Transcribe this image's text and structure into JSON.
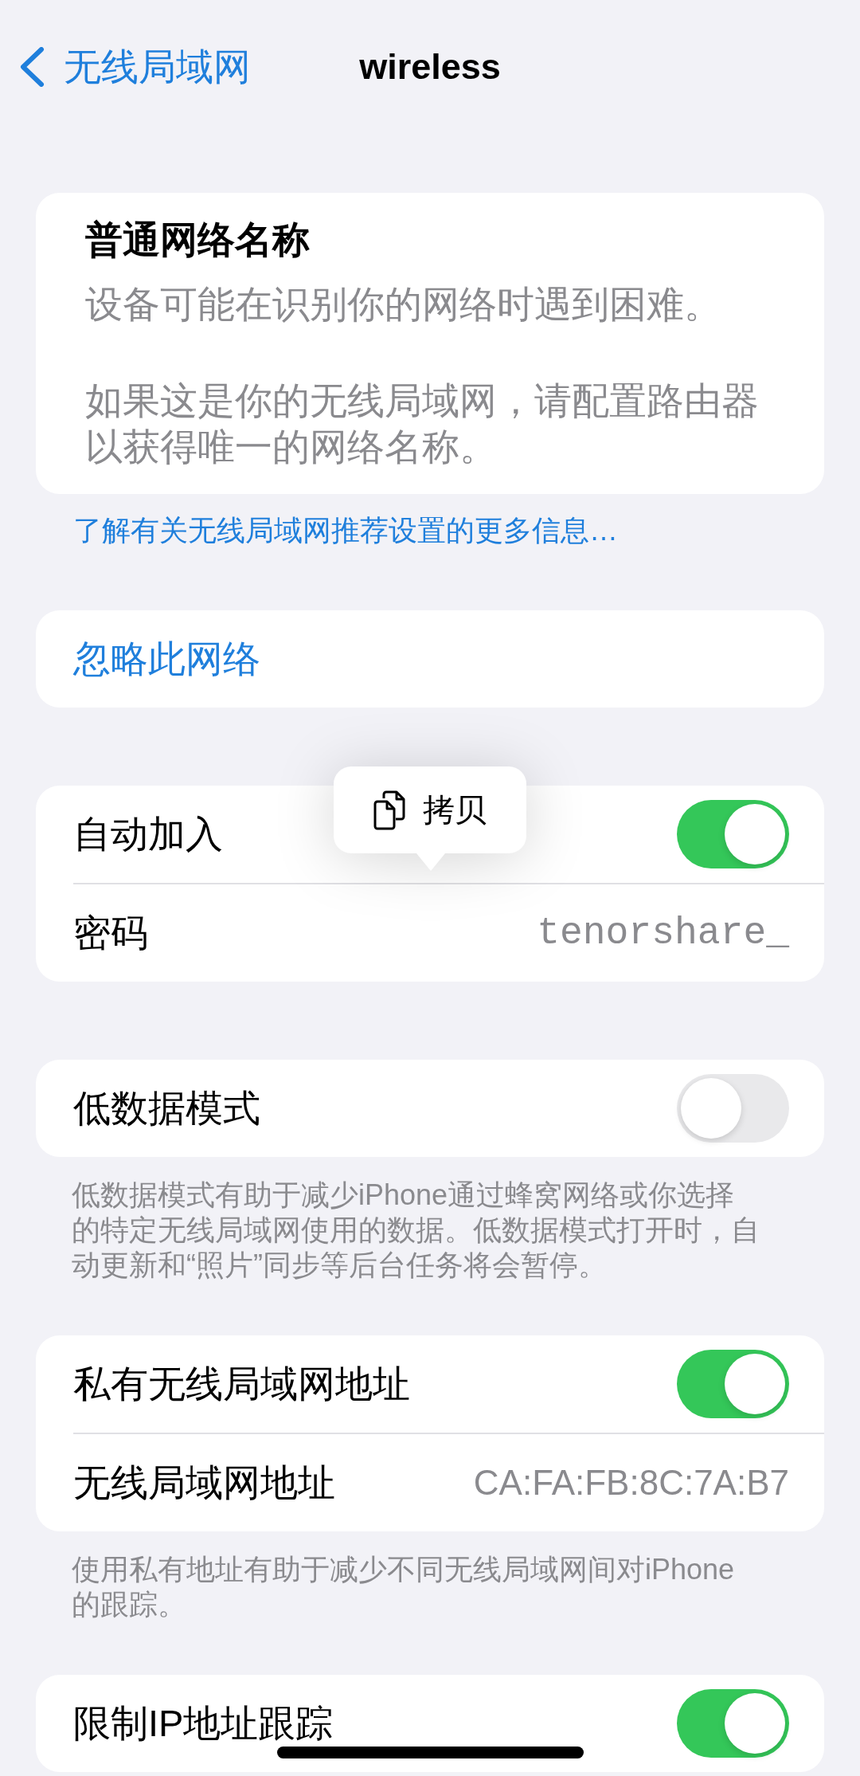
{
  "nav_bar": {
    "back_label": "无线局域网",
    "title": "wireless"
  },
  "sections": [
    {
      "kind": "notice",
      "title": "普通网络名称",
      "paragraphs": [
        "设备可能在识别你的网络时遇到困难。",
        "如果这是你的无线局域网，请配置路由器以获得唯一的网络名称。"
      ],
      "link": "了解有关无线局域网推荐设置的更多信息…"
    },
    {
      "kind": "group",
      "rows": [
        {
          "kind": "action",
          "label": "忽略此网络"
        }
      ]
    },
    {
      "kind": "group",
      "rows": [
        {
          "kind": "toggle",
          "label": "自动加入",
          "on": true
        },
        {
          "kind": "password",
          "label": "密码",
          "value": "tenorshare_"
        }
      ]
    },
    {
      "kind": "group",
      "rows": [
        {
          "kind": "toggle",
          "label": "低数据模式",
          "on": false
        }
      ],
      "footer": "低数据模式有助于减少iPhone通过蜂窝网络或你选择的特定无线局域网使用的数据。低数据模式打开时，自动更新和“照片”同步等后台任务将会暂停。"
    },
    {
      "kind": "group",
      "rows": [
        {
          "kind": "toggle",
          "label": "私有无线局域网地址",
          "on": true
        },
        {
          "kind": "value",
          "label": "无线局域网地址",
          "value": "CA:FA:FB:8C:7A:B7"
        }
      ],
      "footer": "使用私有地址有助于减少不同无线局域网间对iPhone的跟踪。"
    },
    {
      "kind": "group",
      "rows": [
        {
          "kind": "toggle",
          "label": "限制IP地址跟踪",
          "on": true
        }
      ]
    }
  ],
  "copy_menu": {
    "label": "拷贝"
  }
}
